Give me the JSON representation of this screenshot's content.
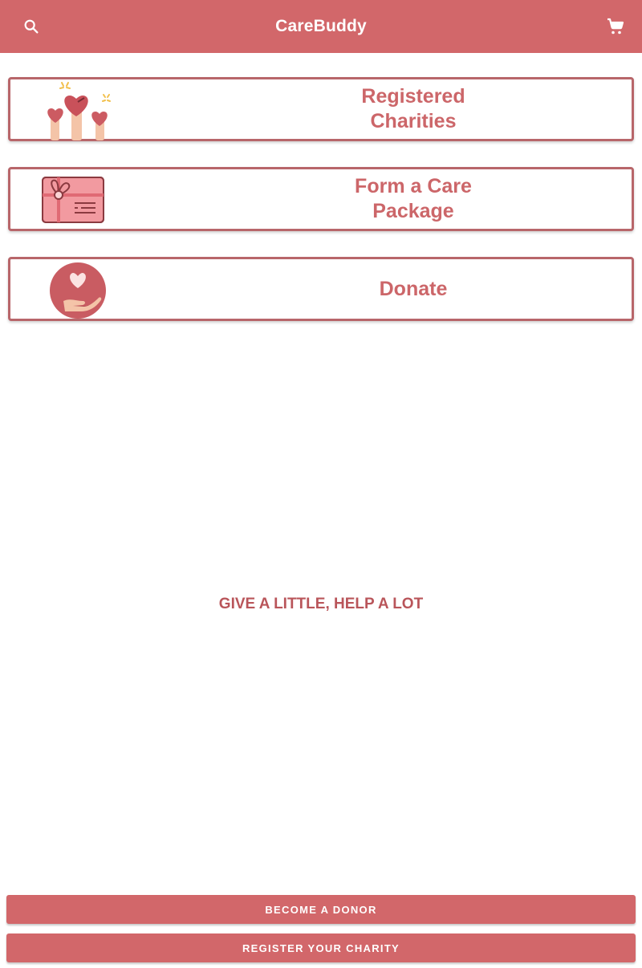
{
  "header": {
    "title": "CareBuddy",
    "search_icon": "search-icon",
    "cart_icon": "shopping-cart-icon"
  },
  "menu": [
    {
      "label_line1": "Registered",
      "label_line2": "Charities",
      "icon": "raised-hands-hearts-icon"
    },
    {
      "label_line1": "Form a Care",
      "label_line2": "Package",
      "icon": "gift-package-icon"
    },
    {
      "label_line1": "Donate",
      "label_line2": "",
      "icon": "heart-in-hand-icon"
    }
  ],
  "tagline": "GIVE A LITTLE, HELP A LOT",
  "buttons": {
    "become_donor": "BECOME A DONOR",
    "register_charity": "REGISTER YOUR CHARITY"
  },
  "colors": {
    "brand": "#d2676a",
    "card_border": "#b8666a",
    "label_text": "#cc6669",
    "tagline_text": "#b9555a"
  }
}
